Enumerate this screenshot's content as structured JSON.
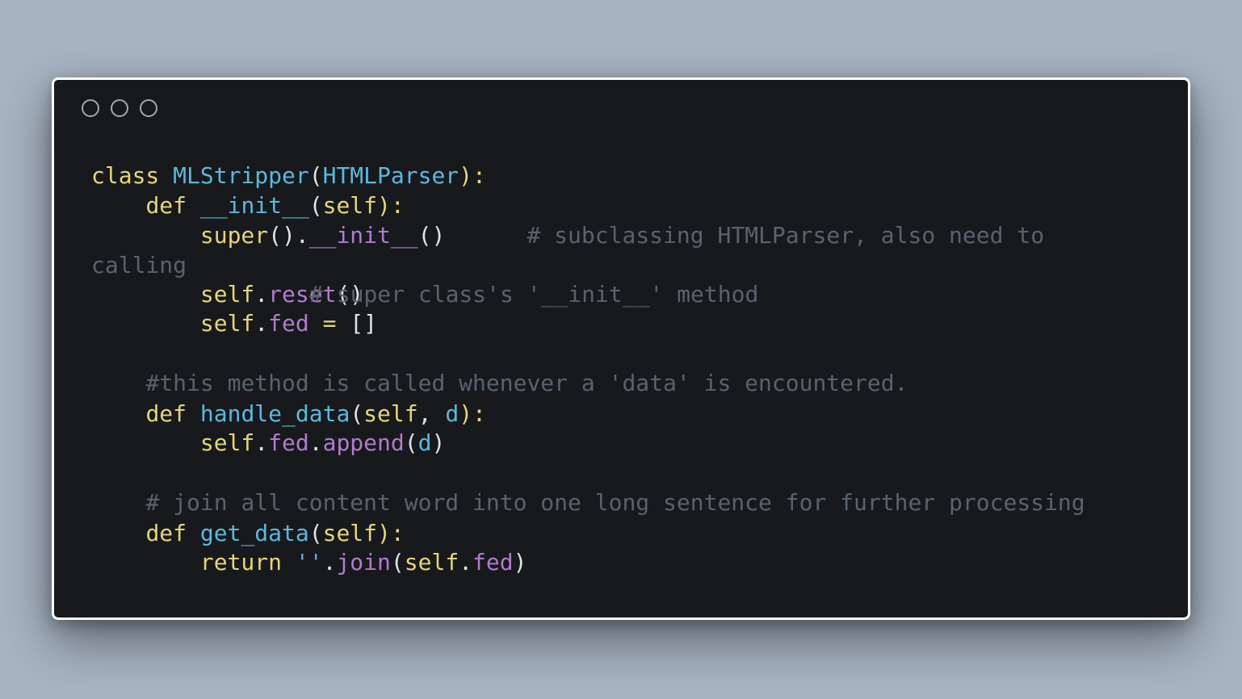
{
  "window": {
    "controls": [
      "window-control-1",
      "window-control-2",
      "window-control-3"
    ]
  },
  "code": {
    "l1": {
      "kw": "class",
      "name": "MLStripper",
      "open": "(",
      "base": "HTMLParser",
      "close": "):"
    },
    "l2": {
      "indent": "    ",
      "kw": "def",
      "name": "__init__",
      "open": "(",
      "self": "self",
      "close": "):"
    },
    "l3": {
      "indent": "        ",
      "super": "super",
      "call": "().",
      "name": "__init__",
      "paren": "()",
      "gap": "      ",
      "comment": "# subclassing HTMLParser, also need to"
    },
    "l4": {
      "comment": "calling"
    },
    "l5": {
      "indent": "        ",
      "self": "self",
      "dot": ".",
      "attr": "reset",
      "paren": "()"
    },
    "l5_comment": {
      "comment": "# super class's '__init__' method"
    },
    "l6": {
      "indent": "        ",
      "self": "self",
      "dot": ".",
      "attr": "fed",
      "op": " = ",
      "val": "[]"
    },
    "l8": {
      "indent": "    ",
      "comment": "#this method is called whenever a 'data' is encountered."
    },
    "l9": {
      "indent": "    ",
      "kw": "def",
      "name": "handle_data",
      "open": "(",
      "self": "self",
      "sep": ", ",
      "arg": "d",
      "close": "):"
    },
    "l10": {
      "indent": "        ",
      "self": "self",
      "dot1": ".",
      "attr1": "fed",
      "dot2": ".",
      "attr2": "append",
      "open": "(",
      "arg": "d",
      "close": ")"
    },
    "l12": {
      "indent": "    ",
      "comment": "# join all content word into one long sentence for further processing"
    },
    "l13": {
      "indent": "    ",
      "kw": "def",
      "name": "get_data",
      "open": "(",
      "self": "self",
      "close": "):"
    },
    "l14": {
      "indent": "        ",
      "kw": "return",
      "sp": " ",
      "str": "''",
      "dot": ".",
      "attr": "join",
      "open": "(",
      "self": "self",
      "dot2": ".",
      "attr2": "fed",
      "close": ")"
    }
  },
  "colors": {
    "background": "#a7b3c1",
    "editor": "#17191c",
    "keyword": "#e6d57a",
    "function": "#5cb8de",
    "attribute": "#b07ccb",
    "comment": "#59636e"
  }
}
